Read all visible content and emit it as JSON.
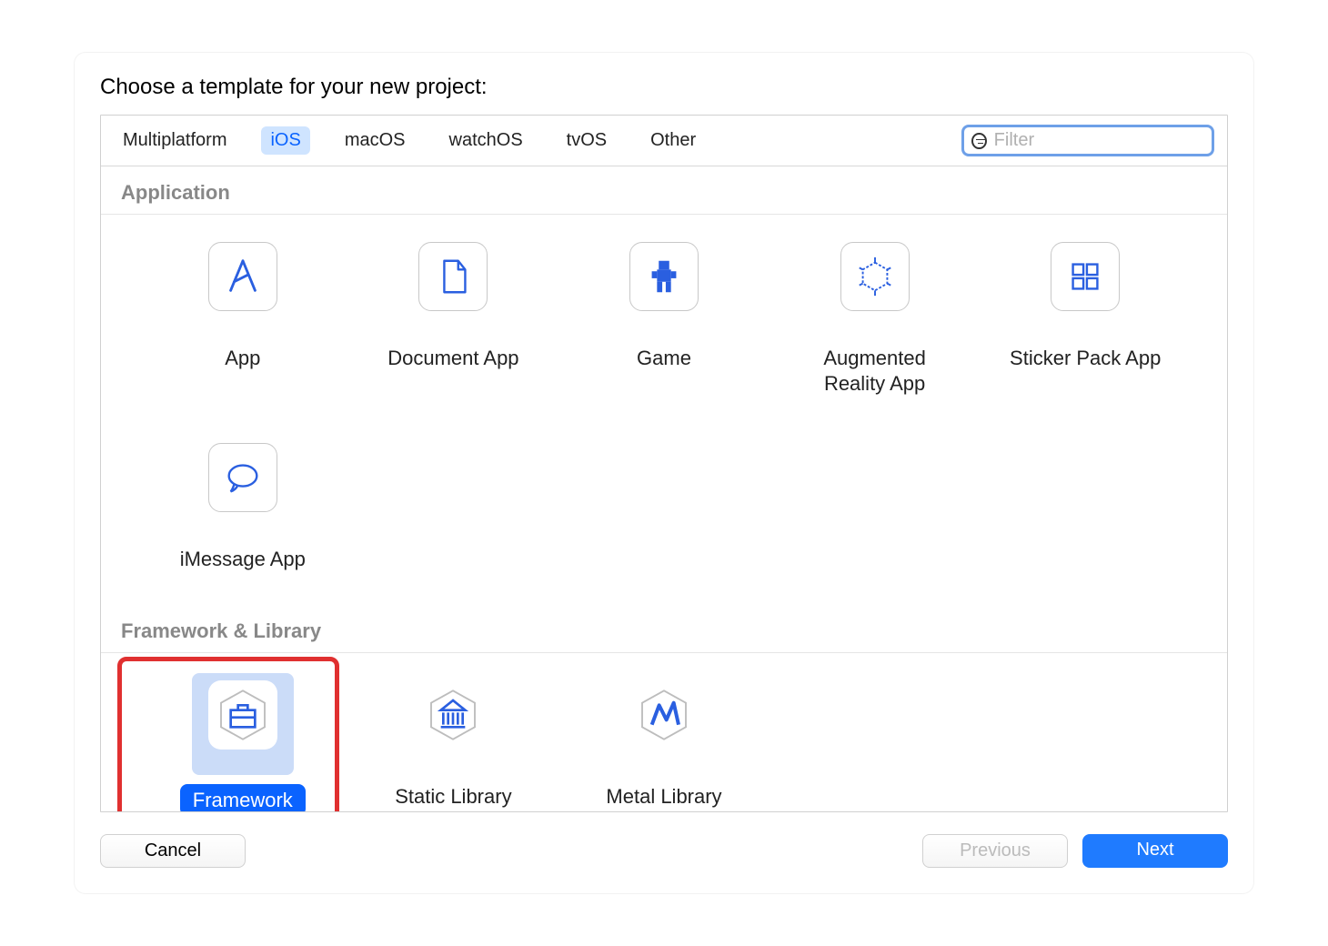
{
  "title": "Choose a template for your new project:",
  "tabs": [
    {
      "label": "Multiplatform",
      "active": false
    },
    {
      "label": "iOS",
      "active": true
    },
    {
      "label": "macOS",
      "active": false
    },
    {
      "label": "watchOS",
      "active": false
    },
    {
      "label": "tvOS",
      "active": false
    },
    {
      "label": "Other",
      "active": false
    }
  ],
  "filter": {
    "placeholder": "Filter",
    "value": ""
  },
  "sections": [
    {
      "header": "Application",
      "items": [
        {
          "label": "App",
          "icon": "app-icon"
        },
        {
          "label": "Document App",
          "icon": "document-icon"
        },
        {
          "label": "Game",
          "icon": "game-icon"
        },
        {
          "label": "Augmented Reality App",
          "icon": "ar-icon"
        },
        {
          "label": "Sticker Pack App",
          "icon": "sticker-icon"
        },
        {
          "label": "iMessage App",
          "icon": "imessage-icon"
        }
      ]
    },
    {
      "header": "Framework & Library",
      "items": [
        {
          "label": "Framework",
          "icon": "framework-icon",
          "selected": true,
          "highlighted": true
        },
        {
          "label": "Static Library",
          "icon": "static-library-icon"
        },
        {
          "label": "Metal Library",
          "icon": "metal-library-icon"
        }
      ]
    }
  ],
  "buttons": {
    "cancel": "Cancel",
    "previous": "Previous",
    "next": "Next",
    "previous_enabled": false
  }
}
